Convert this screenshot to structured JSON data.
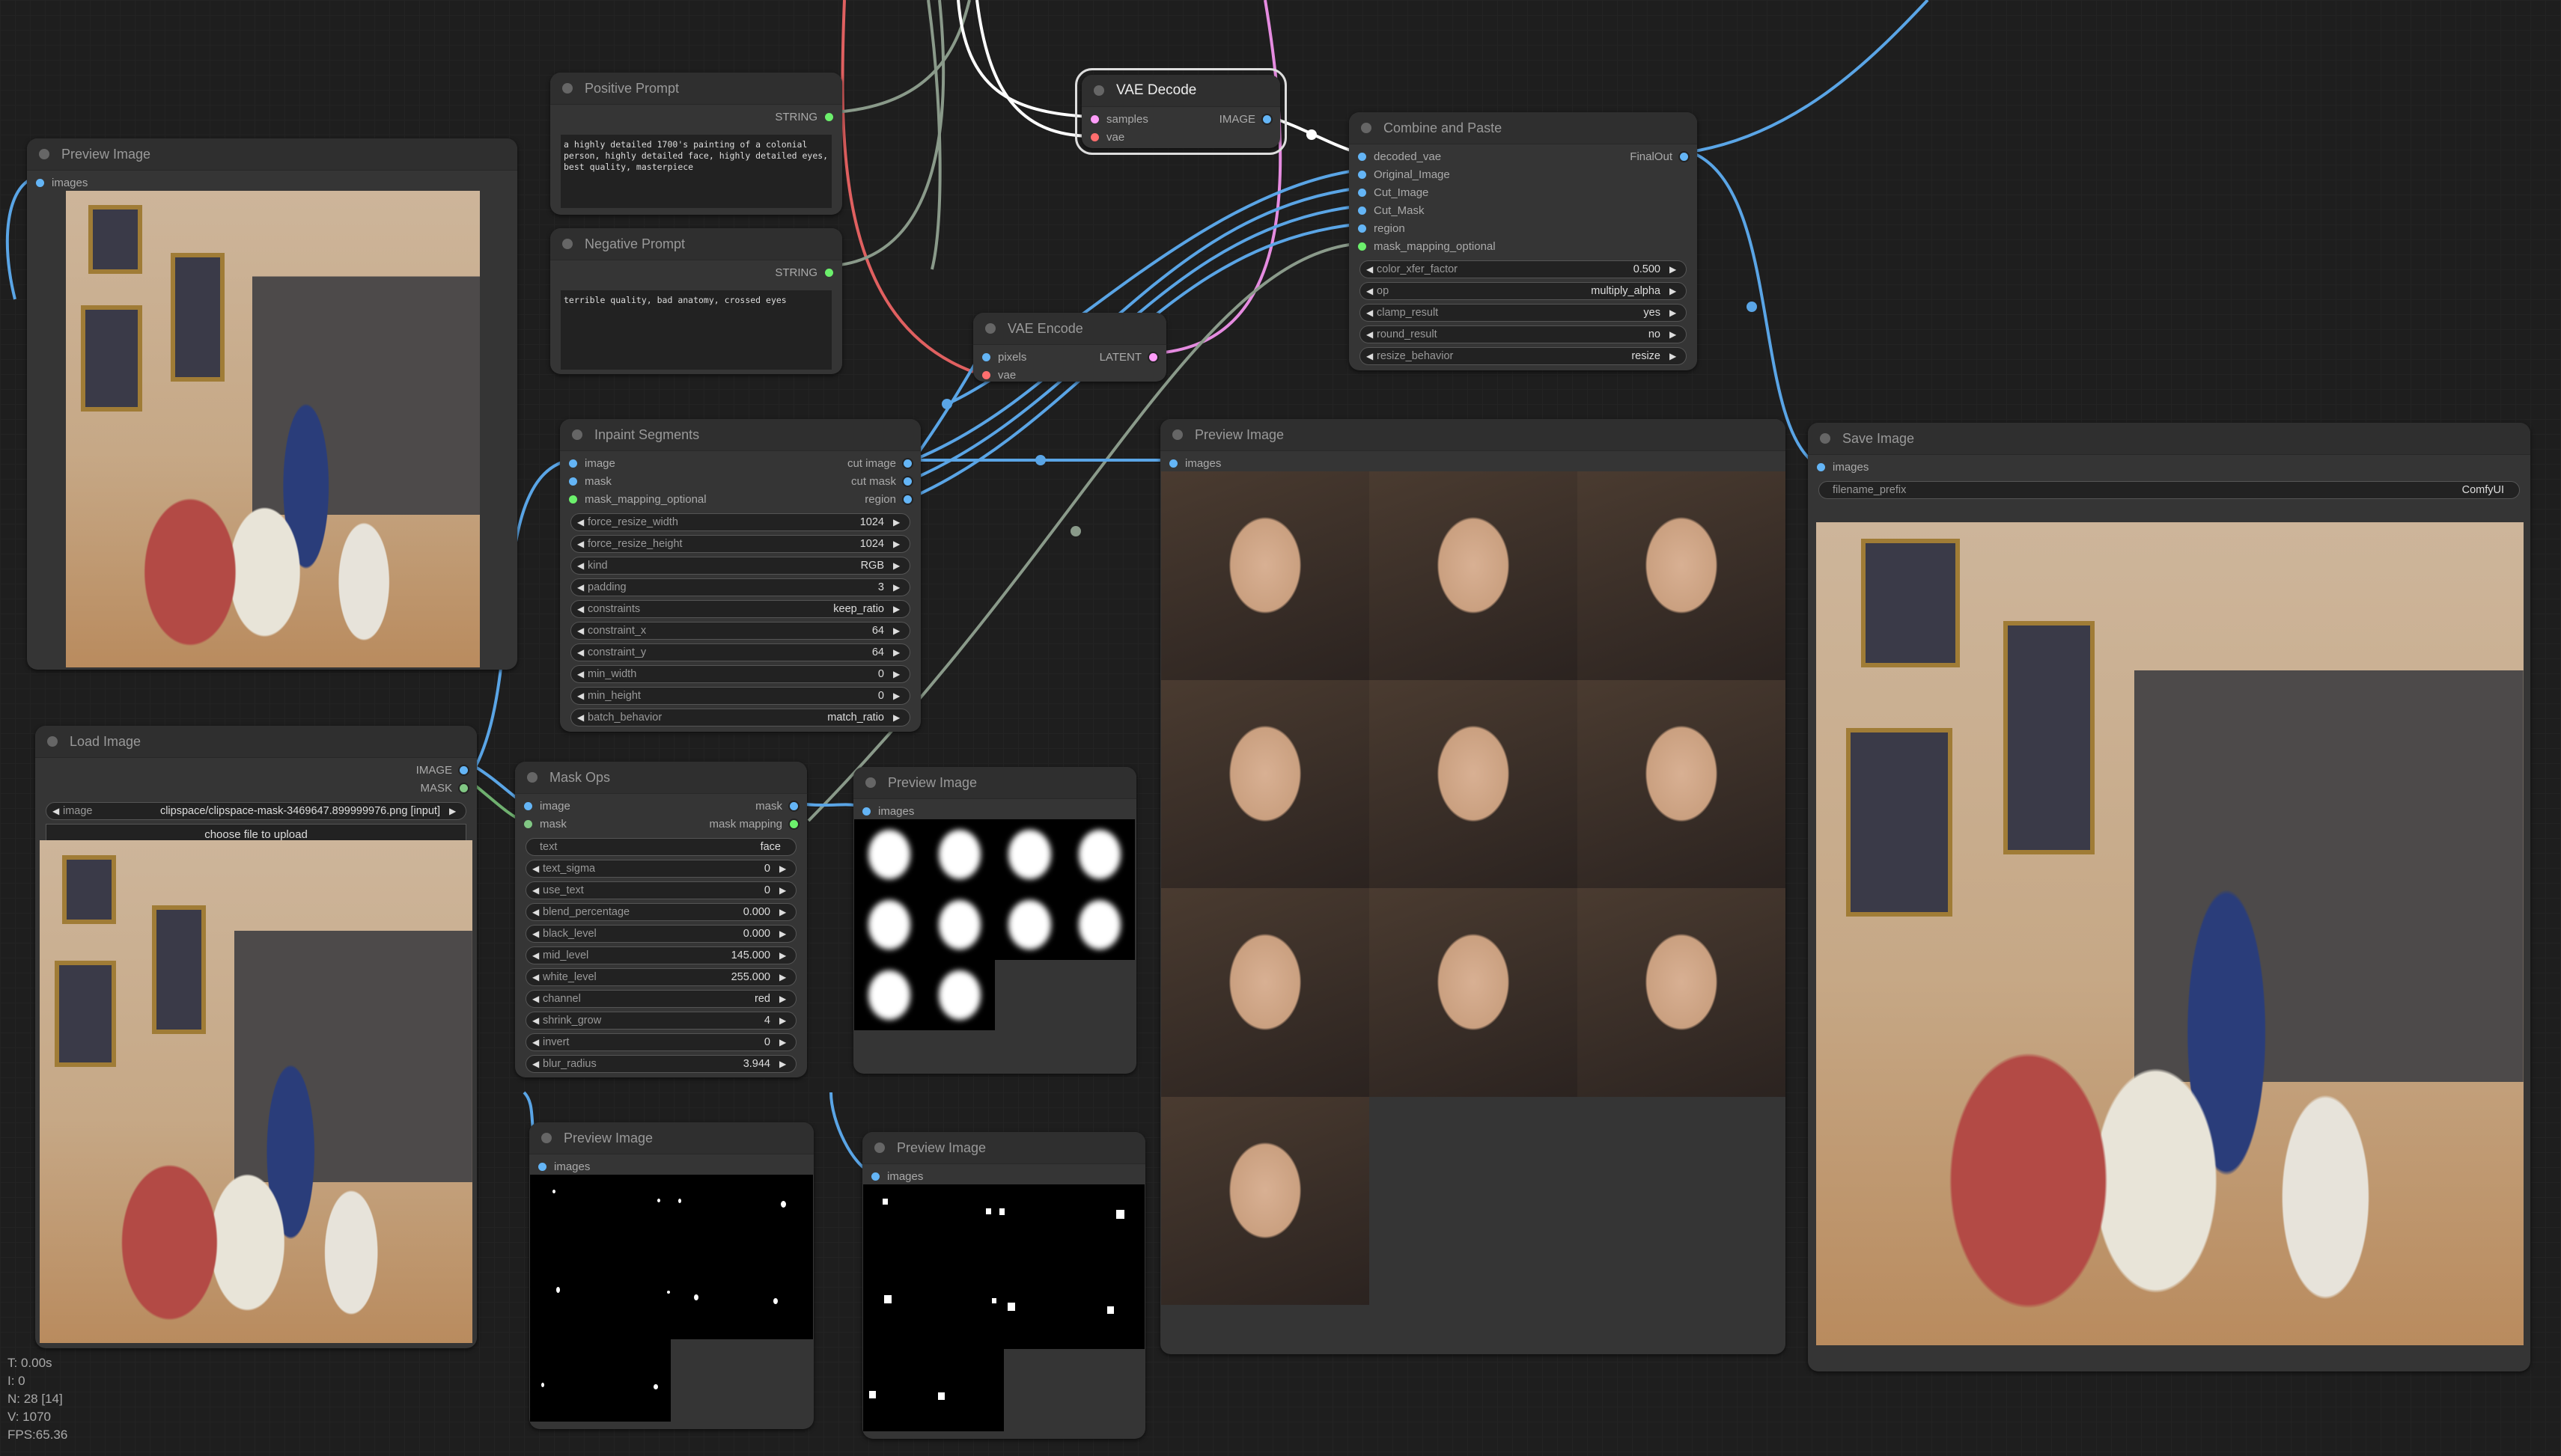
{
  "stats": {
    "t": "T: 0.00s",
    "i": "I: 0",
    "n": "N: 28 [14]",
    "v": "V: 1070",
    "fps": "FPS:65.36"
  },
  "colors": {
    "image": "#64b5f6",
    "mask": "#81c784",
    "string": "#6cf06c",
    "latent": "#ff9cf9",
    "vae": "#ff6e6e",
    "background": "#1e1e1e",
    "node": "#353535"
  },
  "nodes": {
    "preview_top_left": {
      "title": "Preview Image",
      "inputs": [
        "images"
      ]
    },
    "positive_prompt": {
      "title": "Positive Prompt",
      "output": "STRING",
      "text": "a highly detailed 1700's painting of a colonial person, highly detailed face, highly detailed eyes, best quality, masterpiece"
    },
    "negative_prompt": {
      "title": "Negative Prompt",
      "output": "STRING",
      "text": "terrible quality, bad anatomy, crossed eyes"
    },
    "vae_decode": {
      "title": "VAE Decode",
      "inputs": [
        "samples",
        "vae"
      ],
      "output": "IMAGE"
    },
    "vae_encode": {
      "title": "VAE Encode",
      "inputs": [
        "pixels",
        "vae"
      ],
      "output": "LATENT"
    },
    "combine_paste": {
      "title": "Combine and Paste",
      "inputs": [
        "decoded_vae",
        "Original_Image",
        "Cut_Image",
        "Cut_Mask",
        "region",
        "mask_mapping_optional"
      ],
      "output": "FinalOut",
      "widgets": [
        {
          "label": "color_xfer_factor",
          "value": "0.500"
        },
        {
          "label": "op",
          "value": "multiply_alpha"
        },
        {
          "label": "clamp_result",
          "value": "yes"
        },
        {
          "label": "round_result",
          "value": "no"
        },
        {
          "label": "resize_behavior",
          "value": "resize"
        }
      ]
    },
    "inpaint_segments": {
      "title": "Inpaint Segments",
      "inputs": [
        "image",
        "mask",
        "mask_mapping_optional"
      ],
      "outputs": [
        "cut image",
        "cut mask",
        "region"
      ],
      "widgets": [
        {
          "label": "force_resize_width",
          "value": "1024"
        },
        {
          "label": "force_resize_height",
          "value": "1024"
        },
        {
          "label": "kind",
          "value": "RGB"
        },
        {
          "label": "padding",
          "value": "3"
        },
        {
          "label": "constraints",
          "value": "keep_ratio"
        },
        {
          "label": "constraint_x",
          "value": "64"
        },
        {
          "label": "constraint_y",
          "value": "64"
        },
        {
          "label": "min_width",
          "value": "0"
        },
        {
          "label": "min_height",
          "value": "0"
        },
        {
          "label": "batch_behavior",
          "value": "match_ratio"
        }
      ]
    },
    "load_image": {
      "title": "Load Image",
      "outputs": [
        "IMAGE",
        "MASK"
      ],
      "image_label": "image",
      "image_value": "clipspace/clipspace-mask-3469647.899999976.png [input]",
      "upload_label": "choose file to upload"
    },
    "mask_ops": {
      "title": "Mask Ops",
      "inputs": [
        "image",
        "mask"
      ],
      "outputs": [
        "mask",
        "mask mapping"
      ],
      "text_label": "text",
      "text_value": "face",
      "widgets": [
        {
          "label": "text_sigma",
          "value": "0"
        },
        {
          "label": "use_text",
          "value": "0"
        },
        {
          "label": "blend_percentage",
          "value": "0.000"
        },
        {
          "label": "black_level",
          "value": "0.000"
        },
        {
          "label": "mid_level",
          "value": "145.000"
        },
        {
          "label": "white_level",
          "value": "255.000"
        },
        {
          "label": "channel",
          "value": "red"
        },
        {
          "label": "shrink_grow",
          "value": "4"
        },
        {
          "label": "invert",
          "value": "0"
        },
        {
          "label": "blur_radius",
          "value": "3.944"
        }
      ]
    },
    "preview_masks": {
      "title": "Preview Image",
      "inputs": [
        "images"
      ],
      "count": 10
    },
    "preview_dots": {
      "title": "Preview Image",
      "inputs": [
        "images"
      ]
    },
    "preview_squares": {
      "title": "Preview Image",
      "inputs": [
        "images"
      ]
    },
    "preview_faces": {
      "title": "Preview Image",
      "inputs": [
        "images"
      ],
      "count": 10
    },
    "save_image": {
      "title": "Save Image",
      "inputs": [
        "images"
      ],
      "filename_prefix_label": "filename_prefix",
      "filename_prefix_value": "ComfyUI"
    }
  }
}
